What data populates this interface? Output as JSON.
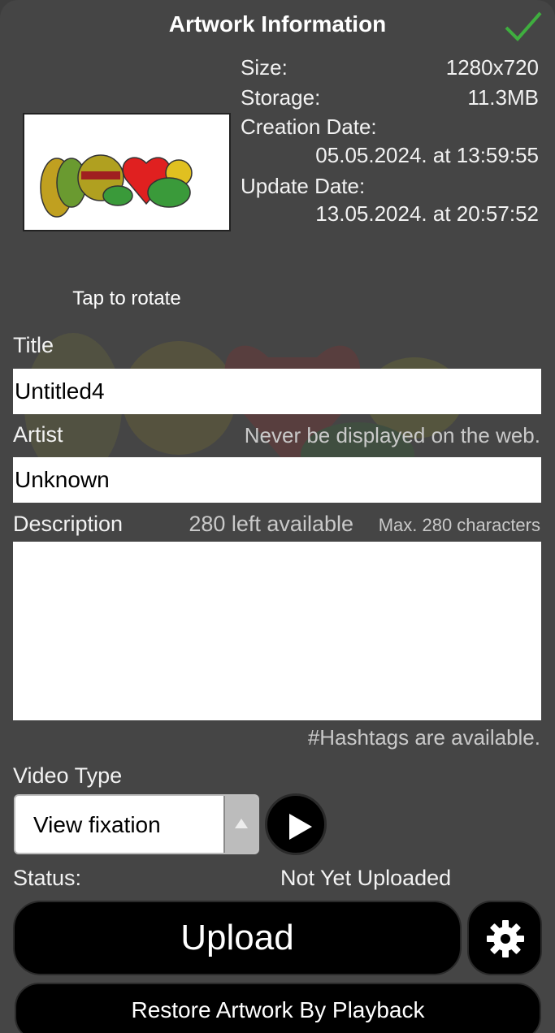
{
  "header": {
    "title": "Artwork Information",
    "confirm_icon": "checkmark-icon",
    "confirm_color": "#3fae3f"
  },
  "info": {
    "size_label": "Size:",
    "size_value": "1280x720",
    "storage_label": "Storage:",
    "storage_value": "11.3MB",
    "creation_label": "Creation Date:",
    "creation_value": "05.05.2024. at 13:59:55",
    "update_label": "Update Date:",
    "update_value": "13.05.2024. at 20:57:52"
  },
  "thumbnail": {
    "rotate_hint": "Tap to rotate"
  },
  "title_field": {
    "label": "Title",
    "value": "Untitled4"
  },
  "artist_field": {
    "label": "Artist",
    "hint": "Never be displayed on the web.",
    "value": "Unknown"
  },
  "description_field": {
    "label": "Description",
    "remaining": "280 left available",
    "max": "Max. 280 characters",
    "value": "",
    "footer_hint": "#Hashtags are available."
  },
  "video_type": {
    "label": "Video Type",
    "selected": "View fixation",
    "play_icon": "play-icon"
  },
  "status": {
    "label": "Status:",
    "value": "Not Yet Uploaded"
  },
  "actions": {
    "upload_label": "Upload",
    "settings_icon": "gear-icon",
    "restore_label": "Restore Artwork By Playback"
  },
  "colors": {
    "panel_bg": "#454545",
    "accent_check": "#3fae3f",
    "button_bg": "#000000"
  }
}
